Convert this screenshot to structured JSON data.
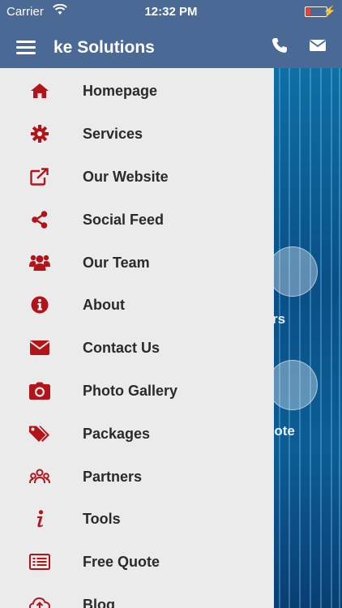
{
  "status_bar": {
    "carrier": "Carrier",
    "time": "12:32 PM"
  },
  "navbar": {
    "title": "ke Solutions"
  },
  "background": {
    "label_1": "rs",
    "label_2": "note"
  },
  "menu": {
    "items": [
      {
        "label": "Homepage",
        "icon": "home-icon"
      },
      {
        "label": "Services",
        "icon": "gear-icon"
      },
      {
        "label": "Our Website",
        "icon": "external-link-icon"
      },
      {
        "label": "Social Feed",
        "icon": "share-icon"
      },
      {
        "label": "Our Team",
        "icon": "users-icon"
      },
      {
        "label": "About",
        "icon": "info-icon"
      },
      {
        "label": "Contact Us",
        "icon": "envelope-icon"
      },
      {
        "label": "Photo Gallery",
        "icon": "camera-icon"
      },
      {
        "label": "Packages",
        "icon": "tags-icon"
      },
      {
        "label": "Partners",
        "icon": "partners-icon"
      },
      {
        "label": "Tools",
        "icon": "tools-icon"
      },
      {
        "label": "Free Quote",
        "icon": "list-icon"
      },
      {
        "label": "Blog",
        "icon": "cloud-upload-icon"
      }
    ]
  },
  "colors": {
    "accent": "#b3141a",
    "navbar": "#4a6a95",
    "drawer": "#ebebeb"
  }
}
